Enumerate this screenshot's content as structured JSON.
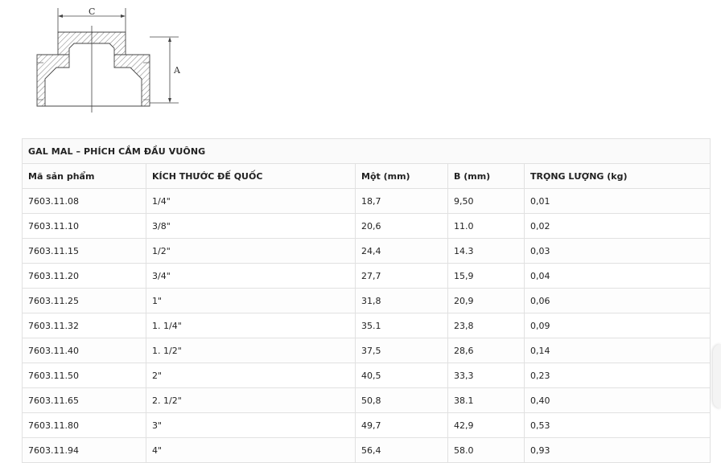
{
  "diagram": {
    "label_c": "C",
    "label_a": "A"
  },
  "table": {
    "caption": "GAL MAL – PHÍCH CẮM ĐẦU VUÔNG",
    "headers": [
      "Mã sản phẩm",
      "KÍCH THƯỚC ĐẾ QUỐC",
      "Một (mm)",
      "B (mm)",
      "TRỌNG LƯỢNG (kg)"
    ],
    "rows": [
      [
        "7603.11.08",
        "1/4\"",
        "18,7",
        "9,50",
        "0,01"
      ],
      [
        "7603.11.10",
        "3/8\"",
        "20,6",
        "11.0",
        "0,02"
      ],
      [
        "7603.11.15",
        "1/2\"",
        "24,4",
        "14.3",
        "0,03"
      ],
      [
        "7603.11.20",
        "3/4\"",
        "27,7",
        "15,9",
        "0,04"
      ],
      [
        "7603.11.25",
        "1\"",
        "31,8",
        "20,9",
        "0,06"
      ],
      [
        "7603.11.32",
        "1. 1/4\"",
        "35.1",
        "23,8",
        "0,09"
      ],
      [
        "7603.11.40",
        "1. 1/2\"",
        "37,5",
        "28,6",
        "0,14"
      ],
      [
        "7603.11.50",
        "2\"",
        "40,5",
        "33,3",
        "0,23"
      ],
      [
        "7603.11.65",
        "2. 1/2\"",
        "50,8",
        "38.1",
        "0,40"
      ],
      [
        "7603.11.80",
        "3\"",
        "49,7",
        "42,9",
        "0,53"
      ],
      [
        "7603.11.94",
        "4\"",
        "56,4",
        "58.0",
        "0,93"
      ]
    ]
  }
}
